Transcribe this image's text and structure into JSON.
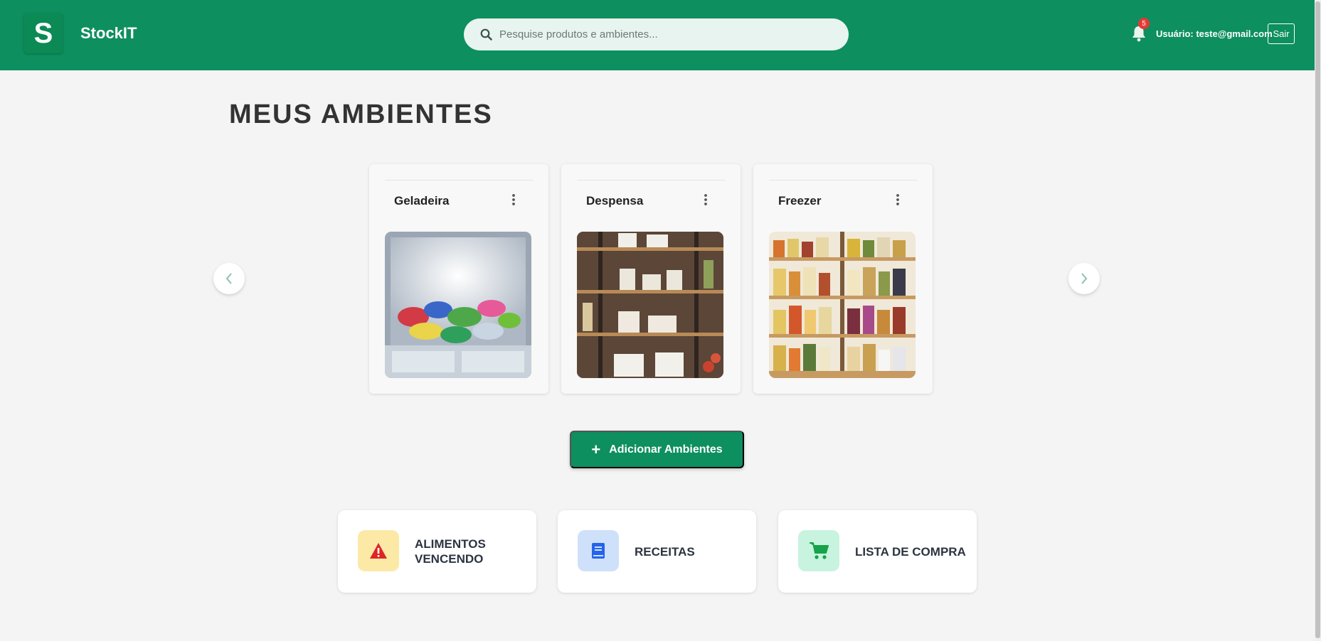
{
  "header": {
    "logo_letter": "S",
    "brand": "StockIT",
    "search_placeholder": "Pesquise produtos e ambientes...",
    "notification_count": "5",
    "user_label": "Usuário: teste@gmail.com",
    "logout_label": "Sair"
  },
  "main": {
    "title": "MEUS AMBIENTES",
    "environments": [
      {
        "name": "Geladeira",
        "image": "freezer-with-frozen-bags"
      },
      {
        "name": "Despensa",
        "image": "pantry-shelves"
      },
      {
        "name": "Freezer",
        "image": "jar-shelves"
      }
    ],
    "add_button_label": "Adicionar Ambientes",
    "tiles": [
      {
        "label": "ALIMENTOS VENCENDO",
        "icon": "warning-icon",
        "bg": "#fde9a6",
        "color": "#dc2626"
      },
      {
        "label": "RECEITAS",
        "icon": "book-icon",
        "bg": "#cfe0fb",
        "color": "#2563eb"
      },
      {
        "label": "LISTA DE COMPRA",
        "icon": "cart-icon",
        "bg": "#c8f3df",
        "color": "#16a34a"
      }
    ]
  },
  "colors": {
    "primary": "#0d8f5f",
    "background": "#f4f4f4"
  }
}
